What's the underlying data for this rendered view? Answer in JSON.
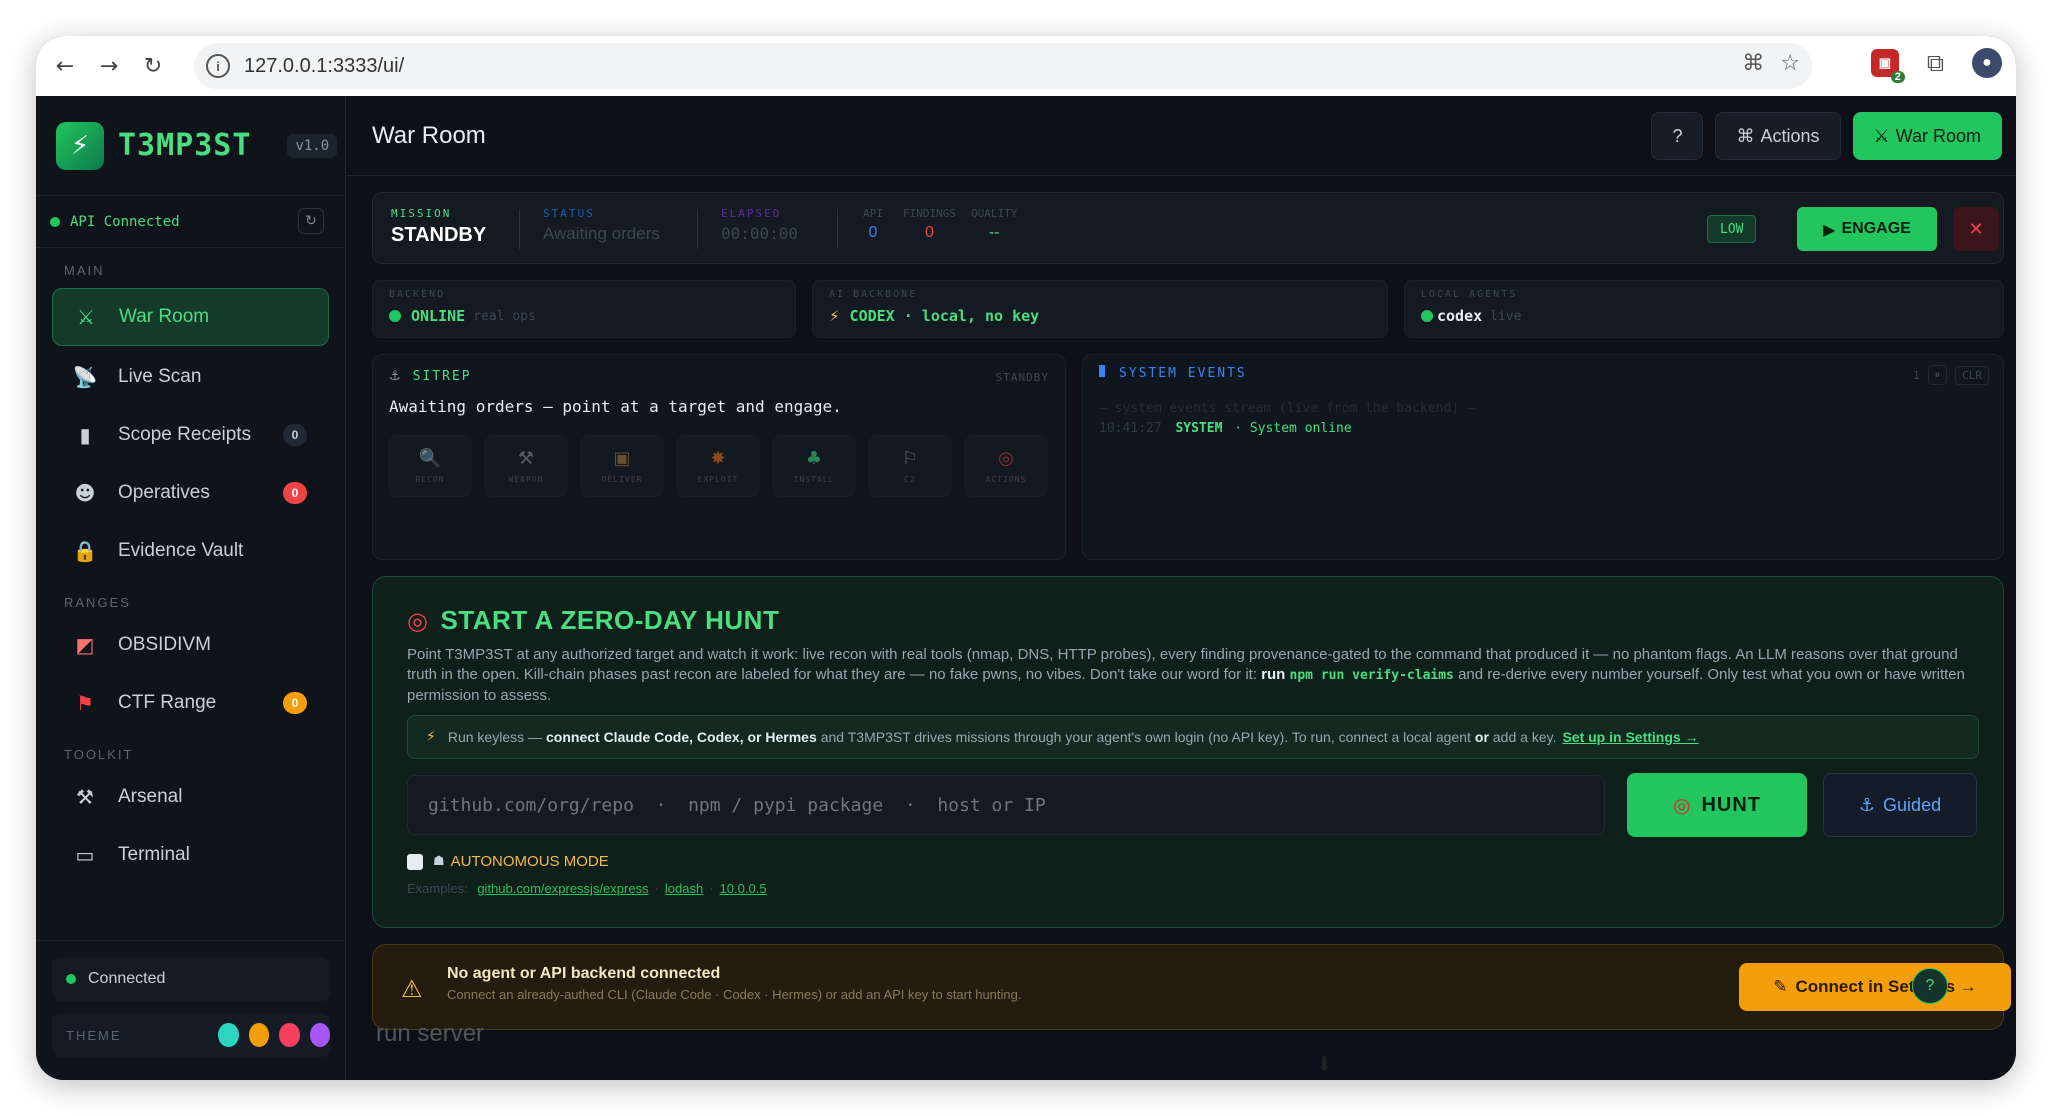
{
  "browser": {
    "url": "127.0.0.1:3333/ui/",
    "ext_badge": "2"
  },
  "brand": {
    "name": "T3MP3ST",
    "version": "v1.0"
  },
  "api": {
    "status": "API Connected"
  },
  "sidebar": {
    "sections": {
      "main": "MAIN",
      "ranges": "RANGES",
      "toolkit": "TOOLKIT"
    },
    "items": [
      {
        "label": "War Room",
        "icon": "swords-icon"
      },
      {
        "label": "Live Scan",
        "icon": "signal-icon"
      },
      {
        "label": "Scope Receipts",
        "icon": "document-icon",
        "badge": "0"
      },
      {
        "label": "Operatives",
        "icon": "mask-icon",
        "badge": "0"
      },
      {
        "label": "Evidence Vault",
        "icon": "lock-icon"
      },
      {
        "label": "OBSIDIVM",
        "icon": "chart-icon"
      },
      {
        "label": "CTF Range",
        "icon": "flag-icon",
        "badge": "0"
      },
      {
        "label": "Arsenal",
        "icon": "wrench-icon"
      },
      {
        "label": "Terminal",
        "icon": "terminal-icon"
      }
    ],
    "connected": "Connected",
    "theme_label": "THEME",
    "theme_colors": [
      "#2dd4bf",
      "#f59e0b",
      "#f43f5e",
      "#a855f7"
    ]
  },
  "header": {
    "title": "War Room",
    "help": "?",
    "actions": "Actions",
    "war_room": "War Room"
  },
  "mission": {
    "mission_k": "MISSION",
    "mission_v": "STANDBY",
    "status_k": "STATUS",
    "status_v": "Awaiting orders",
    "elapsed_k": "ELAPSED",
    "elapsed_v": "00:00:00",
    "api_k": "API",
    "api_v": "0",
    "findings_k": "FINDINGS",
    "findings_v": "0",
    "quality_k": "QUALITY",
    "quality_v": "--",
    "level": "LOW",
    "engage": "ENGAGE"
  },
  "status": {
    "backend_k": "BACKEND",
    "backend_v": "ONLINE",
    "backend_sub": "real ops",
    "ai_k": "AI BACKBONE",
    "ai_v": "CODEX · local, no key",
    "agents_k": "LOCAL AGENTS",
    "agents_v": "codex",
    "agents_sub": "live"
  },
  "sitrep": {
    "title": "SITREP",
    "state": "STANDBY",
    "text": "Awaiting orders — point at a target and engage.",
    "phases": [
      "RECON",
      "WEAPON",
      "DELIVER",
      "EXPLOIT",
      "INSTALL",
      "C2",
      "ACTIONS"
    ]
  },
  "events": {
    "title": "SYSTEM EVENTS",
    "count": "1",
    "pause": "⏸",
    "clear": "CLR",
    "placeholder": "— system events stream (live from the backend) —",
    "time": "10:41:27",
    "source": "SYSTEM",
    "message": "· System online"
  },
  "hunt": {
    "title": "START A ZERO-DAY HUNT",
    "desc1": "Point T3MP3ST at any authorized target and watch it work: live recon with real tools (nmap, DNS, HTTP probes), every finding provenance-gated to the command that produced it — no phantom flags. An LLM reasons over that ground truth in the open. Kill-chain phases past recon are labeled for what they are — no fake pwns, no vibes. Don't take our word for it:",
    "run_word": "run",
    "cmd": "npm run verify-claims",
    "desc2": "and re-derive every number yourself. Only test what you own or have written permission to assess.",
    "keyless_a": "Run keyless —",
    "keyless_b": "connect Claude Code, Codex, or Hermes",
    "keyless_c": "and T3MP3ST drives missions through your agent's own login (no API key). To run, connect a local agent",
    "keyless_or": "or",
    "keyless_d": "add a key.",
    "keyless_link": "Set up in Settings →",
    "placeholder": "github.com/org/repo  ·  npm / pypi package  ·  host or IP",
    "hunt_btn": "HUNT",
    "guided_btn": "Guided",
    "auto": "AUTONOMOUS MODE",
    "examples_label": "Examples:",
    "examples": [
      "github.com/expressjs/express",
      "lodash",
      "10.0.0.5"
    ]
  },
  "warning": {
    "title": "No agent or API backend connected",
    "sub": "Connect an already-authed CLI (Claude Code · Codex · Hermes) or add an API key to start hunting.",
    "button": "Connect in Settings →"
  },
  "behind": "run server"
}
